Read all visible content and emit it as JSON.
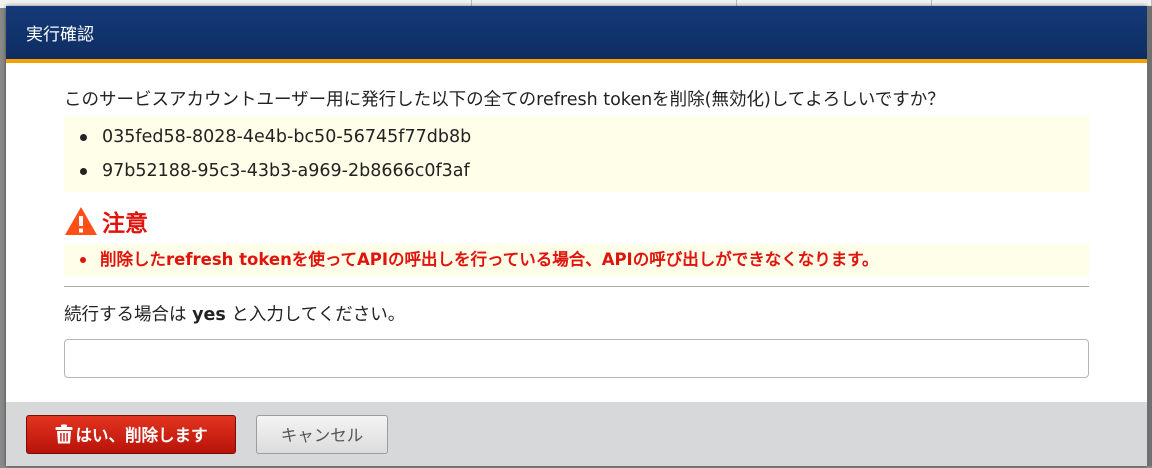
{
  "dialog": {
    "title": "実行確認",
    "question": "このサービスアカウントユーザー用に発行した以下の全てのrefresh tokenを削除(無効化)してよろしいですか？",
    "tokens": [
      "035fed58-8028-4e4b-bc50-56745f77db8b",
      "97b52188-95c3-43b3-a969-2b8666c0f3af"
    ],
    "caution": {
      "icon": "warning-triangle-icon",
      "title": "注意",
      "items": [
        "削除したrefresh tokenを使ってAPIの呼出しを行っている場合、APIの呼び出しができなくなります。"
      ]
    },
    "prompt": {
      "before": "続行する場合は ",
      "keyword": "yes",
      "after": " と入力してください。"
    },
    "input": {
      "value": "",
      "placeholder": ""
    },
    "buttons": {
      "confirm_label": "はい、削除します",
      "confirm_icon": "trash-icon",
      "cancel_label": "キャンセル"
    }
  },
  "colors": {
    "title_bar": "#0e2d62",
    "title_accent": "#f2a100",
    "warning": "#e0140c",
    "highlight_bg": "#fefee9",
    "danger_button": "#c4190c",
    "footer_bg": "#d6d8da"
  }
}
